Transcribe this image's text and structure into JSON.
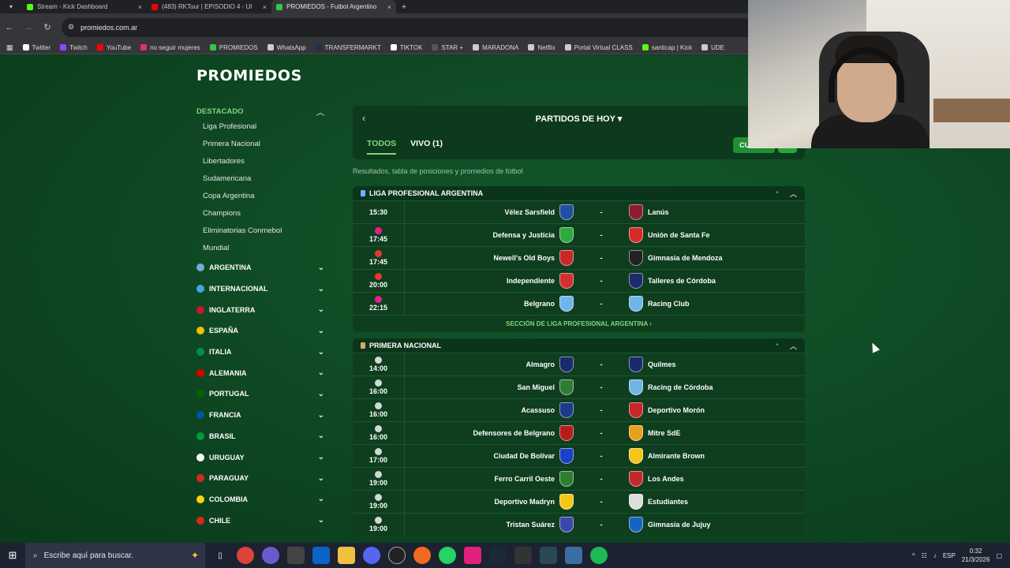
{
  "browser": {
    "tabs": [
      {
        "title": "Stream - Kick Dashboard",
        "favicon_color": "#53fc18",
        "active": false
      },
      {
        "title": "(483) RKTour | EPISODIO 4 - Ul",
        "favicon_color": "#ff0000",
        "active": false
      },
      {
        "title": "PROMIEDOS - Futbol Argentino",
        "favicon_color": "#2ecc40",
        "active": true
      }
    ],
    "new_tab": "+",
    "url": "promiedos.com.ar",
    "bookmarks": [
      {
        "label": "Twitter",
        "color": "#ffffff"
      },
      {
        "label": "Twitch",
        "color": "#9146ff"
      },
      {
        "label": "YouTube",
        "color": "#ff0000"
      },
      {
        "label": "no seguir mujeres",
        "color": "#e1306c"
      },
      {
        "label": "PROMIEDOS",
        "color": "#2ecc40"
      },
      {
        "label": "WhatsApp",
        "color": "#cccccc"
      },
      {
        "label": "TRANSFERMARKT",
        "color": "#1a3151"
      },
      {
        "label": "TIKTOK",
        "color": "#ffffff"
      },
      {
        "label": "STAR +",
        "color": "#555555"
      },
      {
        "label": "MARADONA",
        "color": "#cccccc"
      },
      {
        "label": "Netflix",
        "color": "#cccccc"
      },
      {
        "label": "Portal Virtual CLASS",
        "color": "#cccccc"
      },
      {
        "label": "santicap | Kick",
        "color": "#53fc18"
      },
      {
        "label": "UDE",
        "color": "#cccccc"
      }
    ]
  },
  "site": {
    "logo": "PROMIEDOS",
    "sidebar": {
      "section_title": "DESTACADO",
      "section_items": [
        "Liga Profesional",
        "Primera Nacional",
        "Libertadores",
        "Sudamericana",
        "Copa Argentina",
        "Champions",
        "Eliminatorias Conmebol",
        "Mundial"
      ],
      "countries": [
        {
          "label": "ARGENTINA",
          "color": "#75aadb"
        },
        {
          "label": "INTERNACIONAL",
          "color": "#4aa3df"
        },
        {
          "label": "INGLATERRA",
          "color": "#cf142b"
        },
        {
          "label": "ESPAÑA",
          "color": "#f1bf00"
        },
        {
          "label": "ITALIA",
          "color": "#009246"
        },
        {
          "label": "ALEMANIA",
          "color": "#dd0000"
        },
        {
          "label": "PORTUGAL",
          "color": "#006600"
        },
        {
          "label": "FRANCIA",
          "color": "#0055a4"
        },
        {
          "label": "BRASIL",
          "color": "#009c3b"
        },
        {
          "label": "URUGUAY",
          "color": "#ffffff"
        },
        {
          "label": "PARAGUAY",
          "color": "#d52b1e"
        },
        {
          "label": "COLOMBIA",
          "color": "#fcd116"
        },
        {
          "label": "CHILE",
          "color": "#d52b1e"
        }
      ]
    },
    "main": {
      "header_title": "PARTIDOS DE HOY ▾",
      "tab_all": "TODOS",
      "tab_live": "VIVO (1)",
      "account_label": "CUENTA",
      "subtitle": "Resultados, tabla de posiciones y promedios de fútbol",
      "leagues": [
        {
          "name": "LIGA PROFESIONAL ARGENTINA",
          "footer": "SECCIÓN DE LIGA PROFESIONAL ARGENTINA ›",
          "matches": [
            {
              "time": "15:30",
              "tv": "",
              "home": "Vélez Sarsfield",
              "home_color": "#1f4fa0",
              "away": "Lanús",
              "away_color": "#8b1d2c"
            },
            {
              "time": "17:45",
              "tv": "#e91e8c",
              "home": "Defensa y Justicia",
              "home_color": "#2fa83f",
              "away": "Unión de Santa Fe",
              "away_color": "#d62b2b"
            },
            {
              "time": "17:45",
              "tv": "#e53935",
              "home": "Newell's Old Boys",
              "home_color": "#c62828",
              "away": "Gimnasia de Mendoza",
              "away_color": "#222222"
            },
            {
              "time": "20:00",
              "tv": "#e53935",
              "home": "Independiente",
              "home_color": "#d32f2f",
              "away": "Talleres de Córdoba",
              "away_color": "#1a2a6c"
            },
            {
              "time": "22:15",
              "tv": "#e91e8c",
              "home": "Belgrano",
              "home_color": "#6fb6e8",
              "away": "Racing Club",
              "away_color": "#6fb6e8"
            }
          ]
        },
        {
          "name": "PRIMERA NACIONAL",
          "footer": "",
          "matches": [
            {
              "time": "14:00",
              "tv": "#cfd8dc",
              "home": "Almagro",
              "home_color": "#1a2a6c",
              "away": "Quilmes",
              "away_color": "#1a2a6c"
            },
            {
              "time": "16:00",
              "tv": "#cfd8dc",
              "home": "San Miguel",
              "home_color": "#2e7d32",
              "away": "Racing de Córdoba",
              "away_color": "#6fb6e8"
            },
            {
              "time": "16:00",
              "tv": "#cfd8dc",
              "home": "Acassuso",
              "home_color": "#1a3a8c",
              "away": "Deportivo Morón",
              "away_color": "#c62828"
            },
            {
              "time": "16:00",
              "tv": "#cfd8dc",
              "home": "Defensores de Belgrano",
              "home_color": "#b71c1c",
              "away": "Mitre SdE",
              "away_color": "#e6a11f"
            },
            {
              "time": "17:00",
              "tv": "#cfd8dc",
              "home": "Ciudad De Bolívar",
              "home_color": "#1e40c8",
              "away": "Almirante Brown",
              "away_color": "#f5c518"
            },
            {
              "time": "19:00",
              "tv": "#cfd8dc",
              "home": "Ferro Carril Oeste",
              "home_color": "#2e7d32",
              "away": "Los Andes",
              "away_color": "#c62828"
            },
            {
              "time": "19:00",
              "tv": "#cfd8dc",
              "home": "Deportivo Madryn",
              "home_color": "#f5c518",
              "away": "Estudiantes",
              "away_color": "#dddddd"
            },
            {
              "time": "19:00",
              "tv": "#cfd8dc",
              "home": "Tristan Suárez",
              "home_color": "#3949ab",
              "away": "Gimnasia de Jujuy",
              "away_color": "#1565c0"
            }
          ]
        }
      ]
    }
  },
  "taskbar": {
    "search_placeholder": "Escribe aquí para buscar.",
    "lang": "ESP",
    "time": "0:32",
    "date": "21/3/2026"
  }
}
